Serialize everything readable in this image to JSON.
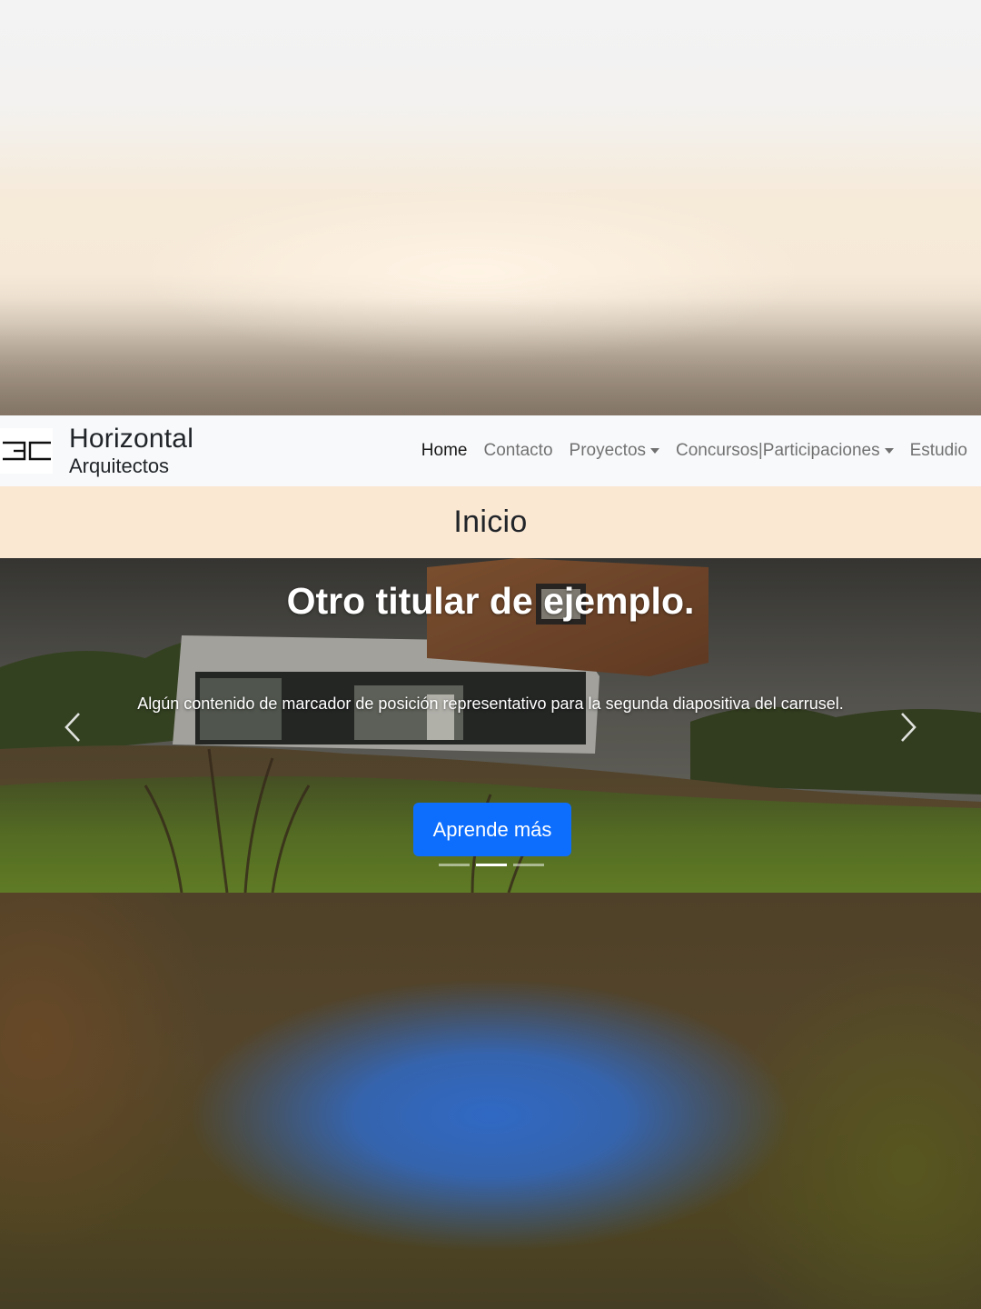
{
  "brand": {
    "title": "Horizontal",
    "subtitle": "Arquitectos",
    "logo_icon": "hc-logo-icon"
  },
  "nav": {
    "items": [
      {
        "label": "Home",
        "active": true
      },
      {
        "label": "Contacto"
      },
      {
        "label": "Proyectos",
        "dropdown": true
      },
      {
        "label": "Concursos|Participaciones",
        "dropdown": true
      },
      {
        "label": "Estudio"
      }
    ]
  },
  "page": {
    "title": "Inicio"
  },
  "carousel": {
    "heading": "Otro titular de ejemplo.",
    "text": "Algún contenido de marcador de posición representativo para la segunda diapositiva del carrusel.",
    "button_label": "Aprende más",
    "slide_count": 3,
    "active_slide": 2,
    "prev_icon": "chevron-left-icon",
    "next_icon": "chevron-right-icon"
  },
  "colors": {
    "navbar_bg": "#f8f9fa",
    "header_band": "#fbe8d3",
    "button_primary": "#0d6efd"
  }
}
